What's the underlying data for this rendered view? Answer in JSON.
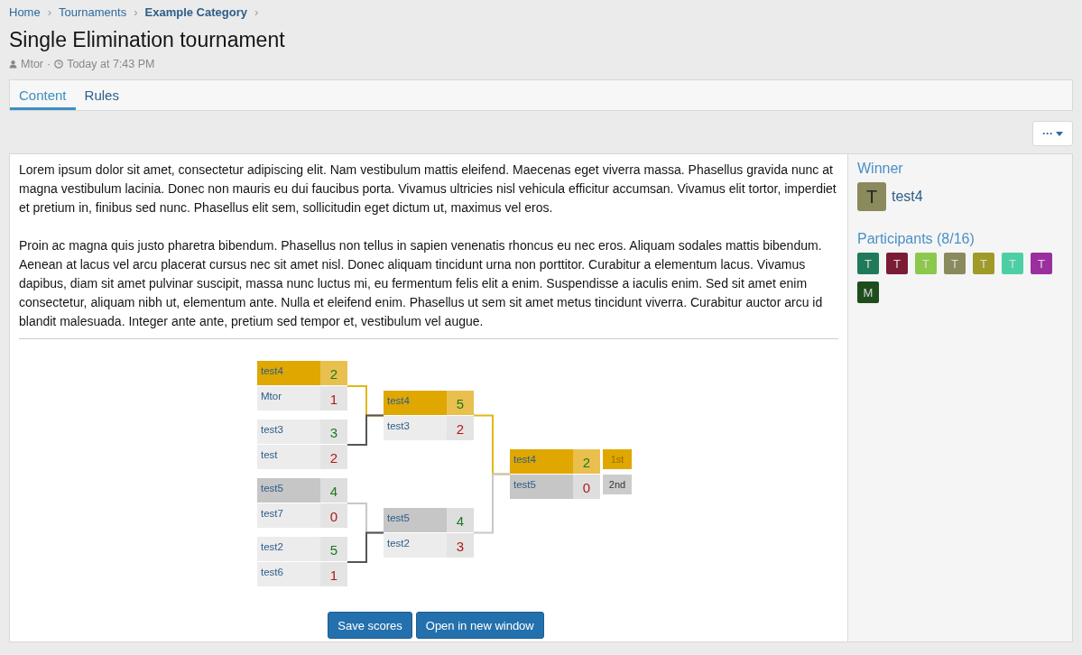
{
  "breadcrumb": [
    {
      "label": "Home",
      "current": false
    },
    {
      "label": "Tournaments",
      "current": false
    },
    {
      "label": "Example Category",
      "current": true
    }
  ],
  "separator": "›",
  "title": "Single Elimination tournament",
  "meta": {
    "author": "Mtor",
    "dot": "·",
    "time": "Today at 7:43 PM"
  },
  "tabs": [
    {
      "label": "Content",
      "selected": true
    },
    {
      "label": "Rules",
      "selected": false
    }
  ],
  "menu_button": {
    "label": "···"
  },
  "paragraphs": [
    "Lorem ipsum dolor sit amet, consectetur adipiscing elit. Nam vestibulum mattis eleifend. Maecenas eget viverra massa. Phasellus gravida nunc at magna vestibulum lacinia. Donec non mauris eu dui faucibus porta. Vivamus ultricies nisl vehicula efficitur accumsan. Vivamus elit tortor, imperdiet et pretium in, finibus sed nunc. Phasellus elit sem, sollicitudin eget dictum ut, maximus vel eros.",
    "Proin ac magna quis justo pharetra bibendum. Phasellus non tellus in sapien venenatis rhoncus eu nec eros. Aliquam sodales mattis bibendum. Aenean at lacus vel arcu placerat cursus nec sit amet nisl. Donec aliquam tincidunt urna non porttitor. Curabitur a elementum lacus. Vivamus dapibus, diam sit amet pulvinar suscipit, massa nunc luctus mi, eu fermentum felis elit a enim. Suspendisse a iaculis enim. Sed sit amet enim consectetur, aliquam nibh ut, elementum ante. Nulla et eleifend enim. Phasellus ut sem sit amet metus tincidunt viverra. Curabitur auctor arcu id blandit malesuada. Integer ante ante, pretium sed tempor et, vestibulum vel augue."
  ],
  "bracket": {
    "rounds": [
      {
        "matches": [
          {
            "players": [
              {
                "name": "test4",
                "score": "2",
                "won": true,
                "kind": "gold"
              },
              {
                "name": "Mtor",
                "score": "1",
                "won": false,
                "kind": "plain"
              }
            ]
          },
          {
            "players": [
              {
                "name": "test3",
                "score": "3",
                "won": true,
                "kind": "plain"
              },
              {
                "name": "test",
                "score": "2",
                "won": false,
                "kind": "plain"
              }
            ]
          },
          {
            "players": [
              {
                "name": "test5",
                "score": "4",
                "won": true,
                "kind": "silver"
              },
              {
                "name": "test7",
                "score": "0",
                "won": false,
                "kind": "plain"
              }
            ]
          },
          {
            "players": [
              {
                "name": "test2",
                "score": "5",
                "won": true,
                "kind": "plain"
              },
              {
                "name": "test6",
                "score": "1",
                "won": false,
                "kind": "plain"
              }
            ]
          }
        ]
      },
      {
        "matches": [
          {
            "players": [
              {
                "name": "test4",
                "score": "5",
                "won": true,
                "kind": "gold"
              },
              {
                "name": "test3",
                "score": "2",
                "won": false,
                "kind": "plain"
              }
            ]
          },
          {
            "players": [
              {
                "name": "test5",
                "score": "4",
                "won": true,
                "kind": "silver"
              },
              {
                "name": "test2",
                "score": "3",
                "won": false,
                "kind": "plain"
              }
            ]
          }
        ]
      },
      {
        "matches": [
          {
            "players": [
              {
                "name": "test4",
                "score": "2",
                "won": true,
                "kind": "gold"
              },
              {
                "name": "test5",
                "score": "0",
                "won": false,
                "kind": "silver"
              }
            ]
          }
        ]
      }
    ],
    "placings": [
      {
        "label": "1st",
        "kind": "gold"
      },
      {
        "label": "2nd",
        "kind": "silver"
      }
    ]
  },
  "buttons": [
    "Save scores",
    "Open in new window"
  ],
  "sidebar": {
    "winner_heading": "Winner",
    "winner": {
      "letter": "T",
      "name": "test4",
      "color": "#8a8a5c"
    },
    "participants_heading": "Participants (8/16)",
    "participants": [
      {
        "letter": "T",
        "color": "#1f7a5a"
      },
      {
        "letter": "T",
        "color": "#7a1c34"
      },
      {
        "letter": "T",
        "color": "#8cc84b"
      },
      {
        "letter": "T",
        "color": "#8a8a5c"
      },
      {
        "letter": "T",
        "color": "#a09a28"
      },
      {
        "letter": "T",
        "color": "#4dcfa6"
      },
      {
        "letter": "T",
        "color": "#9b2fa0"
      },
      {
        "letter": "M",
        "color": "#1e4d1e"
      }
    ]
  }
}
